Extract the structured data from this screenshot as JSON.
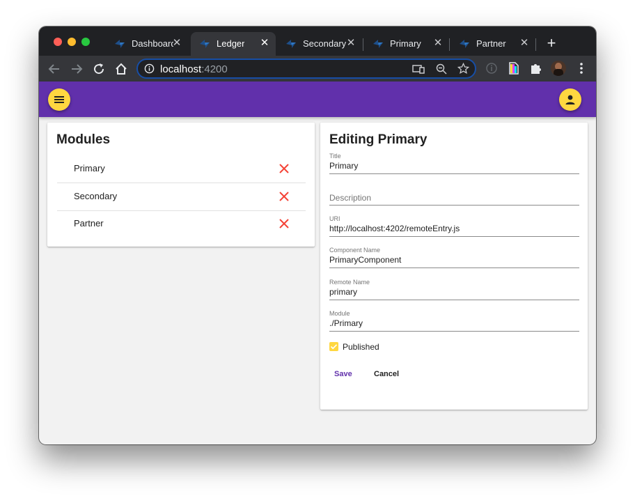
{
  "browser": {
    "tabs": [
      {
        "title": "Dashboard",
        "active": false
      },
      {
        "title": "Ledger",
        "active": true
      },
      {
        "title": "Secondary",
        "active": false
      },
      {
        "title": "Primary",
        "active": false
      },
      {
        "title": "Partner",
        "active": false
      }
    ],
    "address": {
      "host": "localhost",
      "port": ":4200"
    }
  },
  "modules": {
    "title": "Modules",
    "items": [
      {
        "label": "Primary"
      },
      {
        "label": "Secondary"
      },
      {
        "label": "Partner"
      }
    ]
  },
  "editor": {
    "title": "Editing Primary",
    "fields": {
      "title": {
        "label": "Title",
        "value": "Primary"
      },
      "description": {
        "label": "",
        "value": "",
        "placeholder": "Description"
      },
      "uri": {
        "label": "URI",
        "value": "http://localhost:4202/remoteEntry.js"
      },
      "component_name": {
        "label": "Component Name",
        "value": "PrimaryComponent"
      },
      "remote_name": {
        "label": "Remote Name",
        "value": "primary"
      },
      "module": {
        "label": "Module",
        "value": "./Primary"
      }
    },
    "published": {
      "label": "Published",
      "checked": true
    },
    "save_label": "Save",
    "cancel_label": "Cancel"
  },
  "colors": {
    "primary": "#6130ab",
    "accent": "#ffd740",
    "warn": "#f44336"
  }
}
